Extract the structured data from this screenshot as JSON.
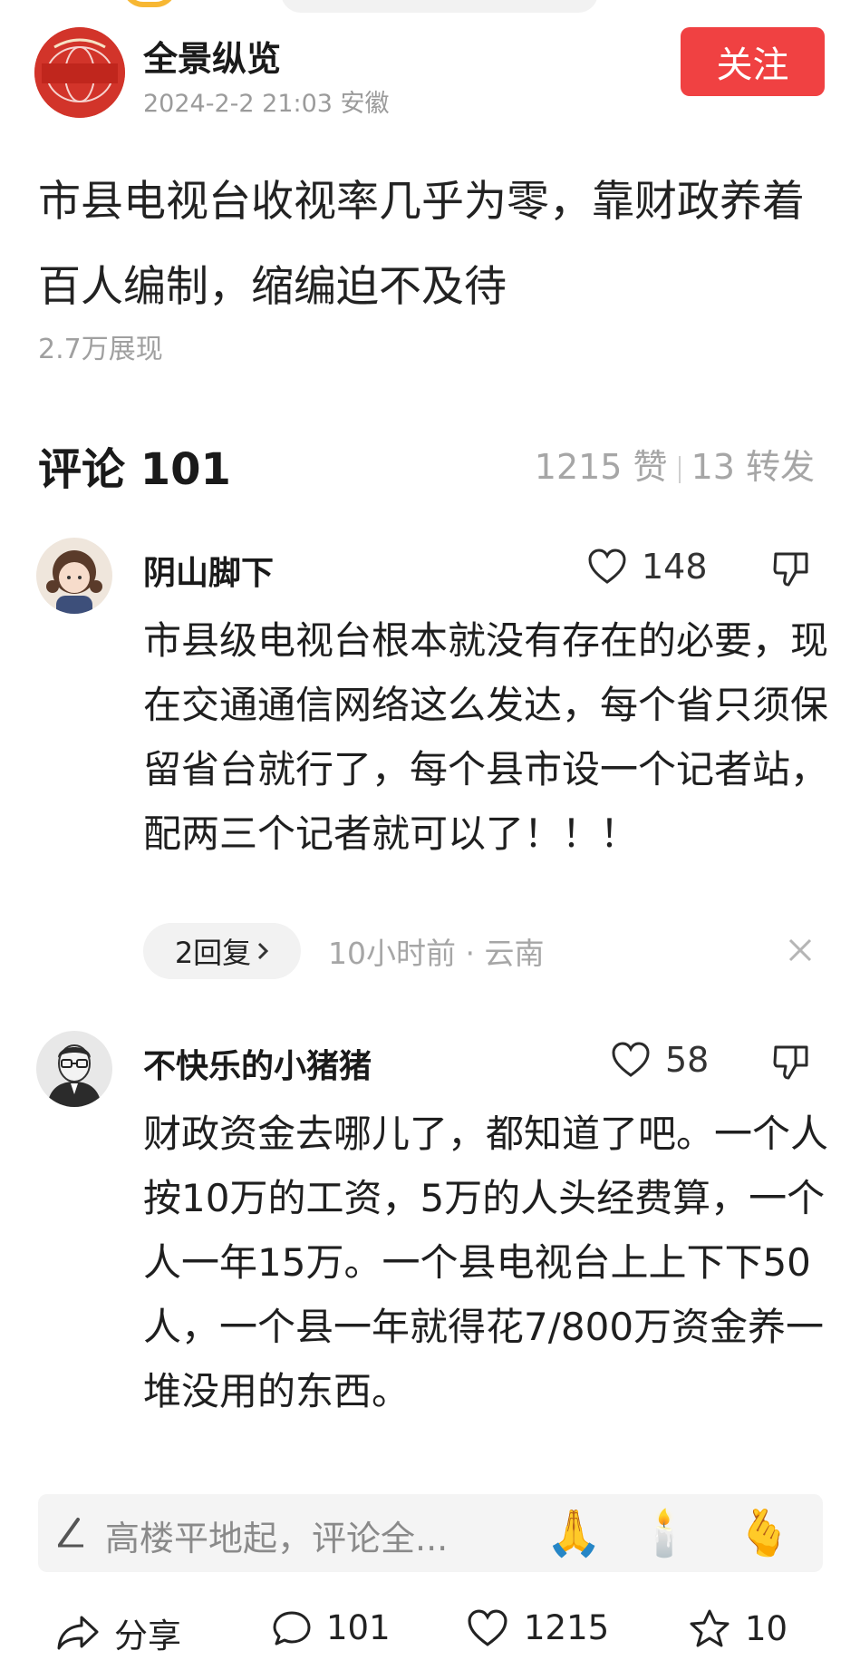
{
  "article": {
    "author_name": "全景纵览",
    "author_logo_text": "全景纵览",
    "published_date": "2024-2-2 21:03",
    "published_location": "安徽",
    "follow_label": "关注",
    "title": "市县电视台收视率几乎为零，靠财政养着百人编制，缩编迫不及待",
    "views": "2.7万展现"
  },
  "comments_section": {
    "header": "评论 101",
    "likes": "1215 赞",
    "shares": "13 转发"
  },
  "comments": [
    {
      "user": "阴山脚下",
      "likes": "148",
      "text": "市县级电视台根本就没有存在的必要，现在交通通信网络这么发达，每个省只须保留省台就行了，每个县市设一个记者站，配两三个记者就可以了！！！",
      "replies_label": "2回复",
      "time_location": "10小时前 · 云南"
    },
    {
      "user": "不快乐的小猪猪",
      "likes": "58",
      "text": "财政资金去哪儿了，都知道了吧。一个人按10万的工资，5万的人头经费算，一个人一年15万。一个县电视台上上下下50人，一个县一年就得花7/800万资金养一堆没用的东西。"
    }
  ],
  "comment_input": {
    "placeholder": "高楼平地起，评论全...",
    "emoji_pray": "🙏",
    "emoji_candle": "🕯️",
    "emoji_heart": "🫰"
  },
  "bottom_bar": {
    "share_label": "分享",
    "comment_count": "101",
    "like_count": "1215",
    "favorite_count": "10"
  },
  "colors": {
    "accent_red": "#f04142",
    "muted_text": "#a6a6a6"
  }
}
